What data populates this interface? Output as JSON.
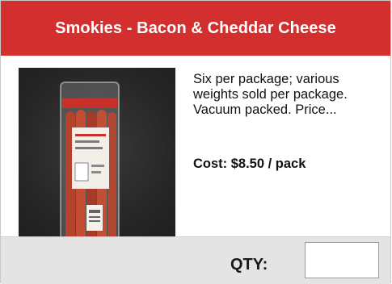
{
  "product": {
    "title": "Smokies - Bacon & Cheddar Cheese",
    "description": "Six per package; various weights sold per package. Vacuum packed. Price...",
    "cost": "Cost: $8.50 / pack",
    "image_label": "product photo of vacuum packed smokies"
  },
  "order": {
    "qty_label": "QTY:",
    "qty_value": ""
  },
  "colors": {
    "header_bg": "#d32f2f",
    "footer_bg": "#e4e4e4"
  }
}
